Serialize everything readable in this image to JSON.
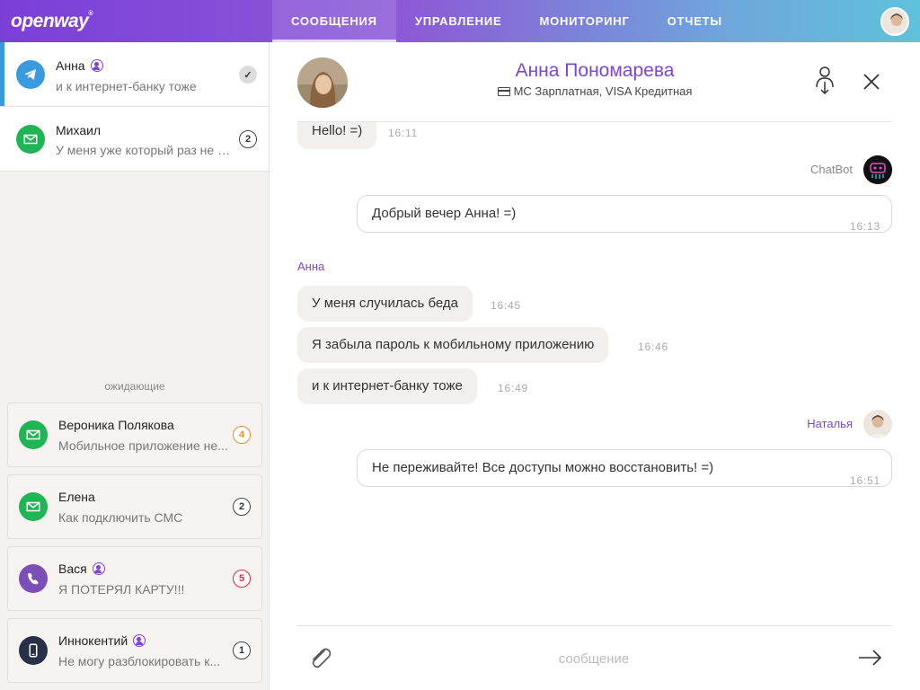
{
  "header": {
    "logo": "openway",
    "logo_mark": "®",
    "tabs": [
      {
        "label": "СООБЩЕНИЯ",
        "active": true
      },
      {
        "label": "УПРАВЛЕНИЕ",
        "active": false
      },
      {
        "label": "МОНИТОРИНГ",
        "active": false
      },
      {
        "label": "ОТЧЕТЫ",
        "active": false
      }
    ]
  },
  "active_chats": [
    {
      "name": "Анна",
      "preview": "и к интернет-банку тоже",
      "channel": "telegram-icon",
      "status": "✓",
      "selected": true,
      "identified": true
    },
    {
      "name": "Михаил",
      "preview": "У меня уже который раз не п...",
      "channel": "mail-icon",
      "status": "2",
      "selected": false,
      "identified": false
    }
  ],
  "waiting_label": "ожидающие",
  "waiting_chats": [
    {
      "name": "Вероника Полякова",
      "preview": "Мобильное приложение не...",
      "channel": "mail-icon",
      "count": "4",
      "badge_color": "#f08a2a",
      "identified": false
    },
    {
      "name": "Елена",
      "preview": "Как подключить СМС",
      "channel": "mail-icon",
      "count": "2",
      "badge_color": "#444444",
      "identified": false
    },
    {
      "name": "Вася",
      "preview": "Я ПОТЕРЯЛ КАРТУ!!!",
      "channel": "viber-icon",
      "count": "5",
      "badge_color": "#e0283a",
      "identified": true
    },
    {
      "name": "Иннокентий",
      "preview": "Не могу разблокировать к...",
      "channel": "phone-icon",
      "count": "1",
      "badge_color": "#444444",
      "identified": true
    }
  ],
  "conversation": {
    "contact_name": "Анна Пономарева",
    "products": "МС Зарплатная, VISA Кредитная",
    "messages": [
      {
        "text": "Hello! =)",
        "time": "16:11"
      },
      {
        "sender": "ChatBot",
        "text": "Добрый вечер Анна! =)",
        "time": "16:13"
      },
      {
        "sender": "Анна",
        "text": "У меня случилась беда",
        "time": "16:45"
      },
      {
        "text": "Я забыла пароль к мобильному приложению",
        "time": "16:46"
      },
      {
        "text": "и к интернет-банку тоже",
        "time": "16:49"
      },
      {
        "sender": "Наталья",
        "text": "Не переживайте! Все доступы можно восстановить! =)",
        "time": "16:51"
      }
    ]
  },
  "composer": {
    "placeholder": "сообщение"
  },
  "colors": {
    "accent": "#7d45d4",
    "telegram": "#3a9ae0",
    "mail": "#1fb454",
    "viber": "#7b4fb6"
  }
}
